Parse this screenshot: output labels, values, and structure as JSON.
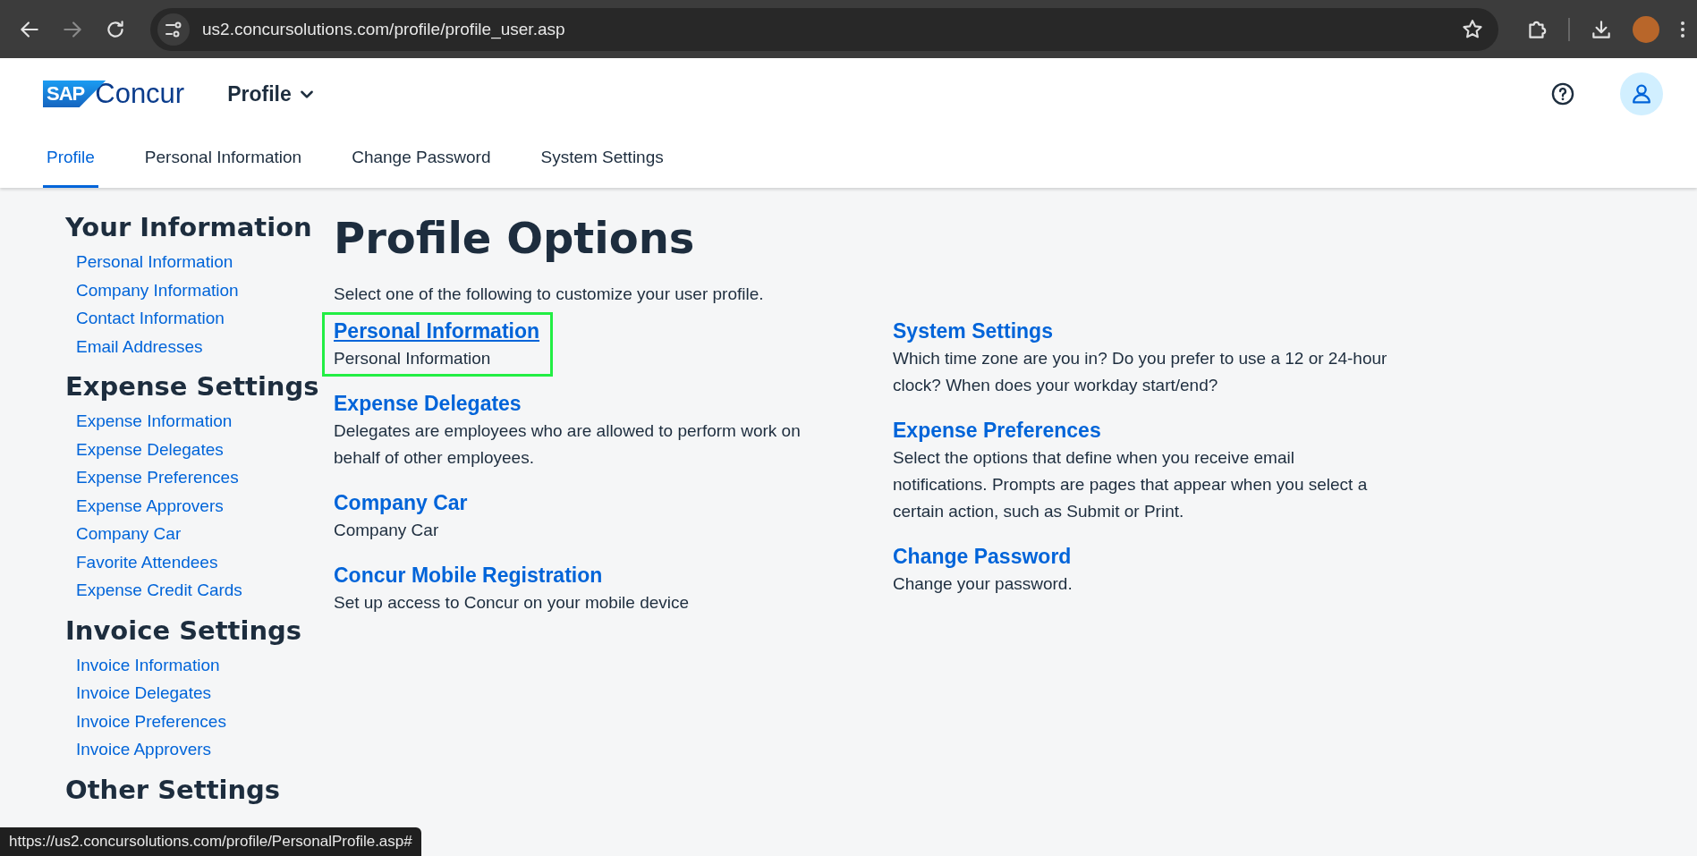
{
  "browser": {
    "url": "us2.concursolutions.com/profile/profile_user.asp",
    "back_enabled": true,
    "forward_enabled": false
  },
  "header": {
    "logo_text": "Concur",
    "logo_badge": "SAP",
    "app_menu": "Profile"
  },
  "tabs": [
    {
      "label": "Profile",
      "selected": true
    },
    {
      "label": "Personal Information",
      "selected": false
    },
    {
      "label": "Change Password",
      "selected": false
    },
    {
      "label": "System Settings",
      "selected": false
    }
  ],
  "sidebar": [
    {
      "heading": "Your Information",
      "links": [
        "Personal Information",
        "Company Information",
        "Contact Information",
        "Email Addresses"
      ]
    },
    {
      "heading": "Expense Settings",
      "links": [
        "Expense Information",
        "Expense Delegates",
        "Expense Preferences",
        "Expense Approvers",
        "Company Car",
        "Favorite Attendees",
        "Expense Credit Cards"
      ]
    },
    {
      "heading": "Invoice Settings",
      "links": [
        "Invoice Information",
        "Invoice Delegates",
        "Invoice Preferences",
        "Invoice Approvers"
      ]
    },
    {
      "heading": "Other Settings"
    }
  ],
  "main": {
    "title": "Profile Options",
    "intro": "Select one of the following to customize your user profile.",
    "columns": [
      {
        "options": [
          {
            "title": "Personal Information",
            "description": "Personal Information",
            "hovered": true
          },
          {
            "title": "Expense Delegates",
            "description": "Delegates are employees who are allowed to perform work on behalf of other employees.",
            "hovered": false
          },
          {
            "title": "Company Car",
            "description": "Company Car",
            "hovered": false
          },
          {
            "title": "Concur Mobile Registration",
            "description": "Set up access to Concur on your mobile device",
            "hovered": false
          }
        ]
      },
      {
        "options": [
          {
            "title": "System Settings",
            "description": "Which time zone are you in? Do you prefer to use a 12 or 24-hour clock? When does your workday start/end?",
            "hovered": false
          },
          {
            "title": "Expense Preferences",
            "description": "Select the options that define when you receive email notifications. Prompts are pages that appear when you select a certain action, such as Submit or Print.",
            "hovered": false
          },
          {
            "title": "Change Password",
            "description": "Change your password.",
            "hovered": false
          }
        ]
      }
    ]
  },
  "status_url": "https://us2.concursolutions.com/profile/PersonalProfile.asp#"
}
